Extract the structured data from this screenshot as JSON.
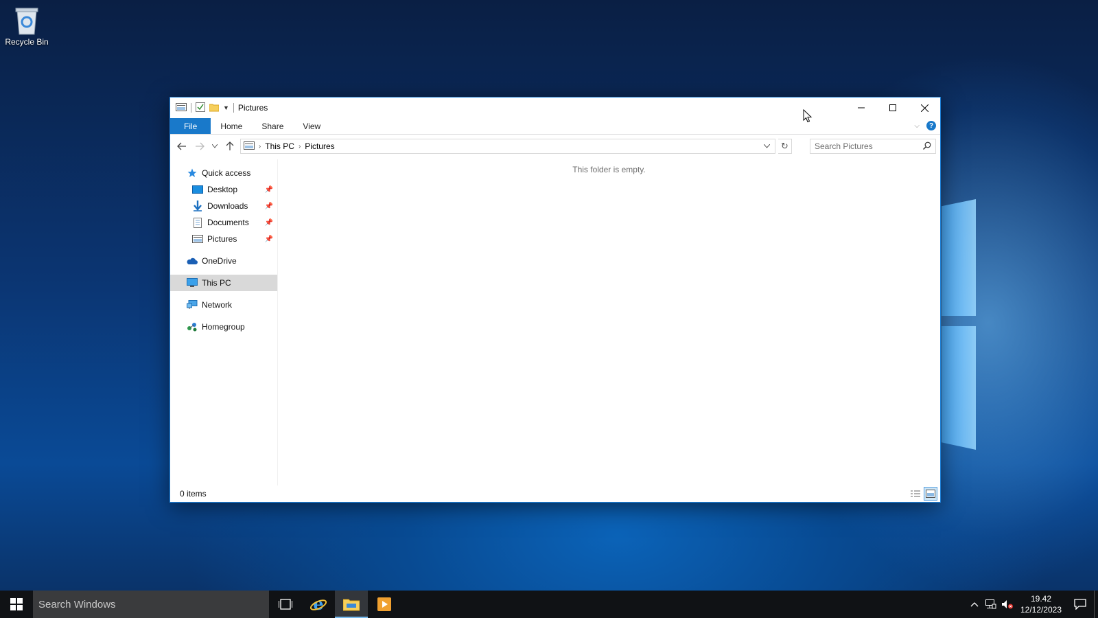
{
  "desktop": {
    "recycle_bin_label": "Recycle Bin"
  },
  "window": {
    "title": "Pictures",
    "ribbon_tabs": {
      "file": "File",
      "home": "Home",
      "share": "Share",
      "view": "View"
    },
    "breadcrumb": [
      "This PC",
      "Pictures"
    ],
    "search_placeholder": "Search Pictures",
    "empty_message": "This folder is empty.",
    "status": "0 items",
    "nav": {
      "quick_access": "Quick access",
      "desktop": "Desktop",
      "downloads": "Downloads",
      "documents": "Documents",
      "pictures": "Pictures",
      "onedrive": "OneDrive",
      "this_pc": "This PC",
      "network": "Network",
      "homegroup": "Homegroup"
    }
  },
  "taskbar": {
    "search_placeholder": "Search Windows",
    "time": "19.42",
    "date": "12/12/2023"
  },
  "colors": {
    "accent": "#1979ca",
    "taskbar": "#101215",
    "selected_nav": "#d9d9d9"
  }
}
